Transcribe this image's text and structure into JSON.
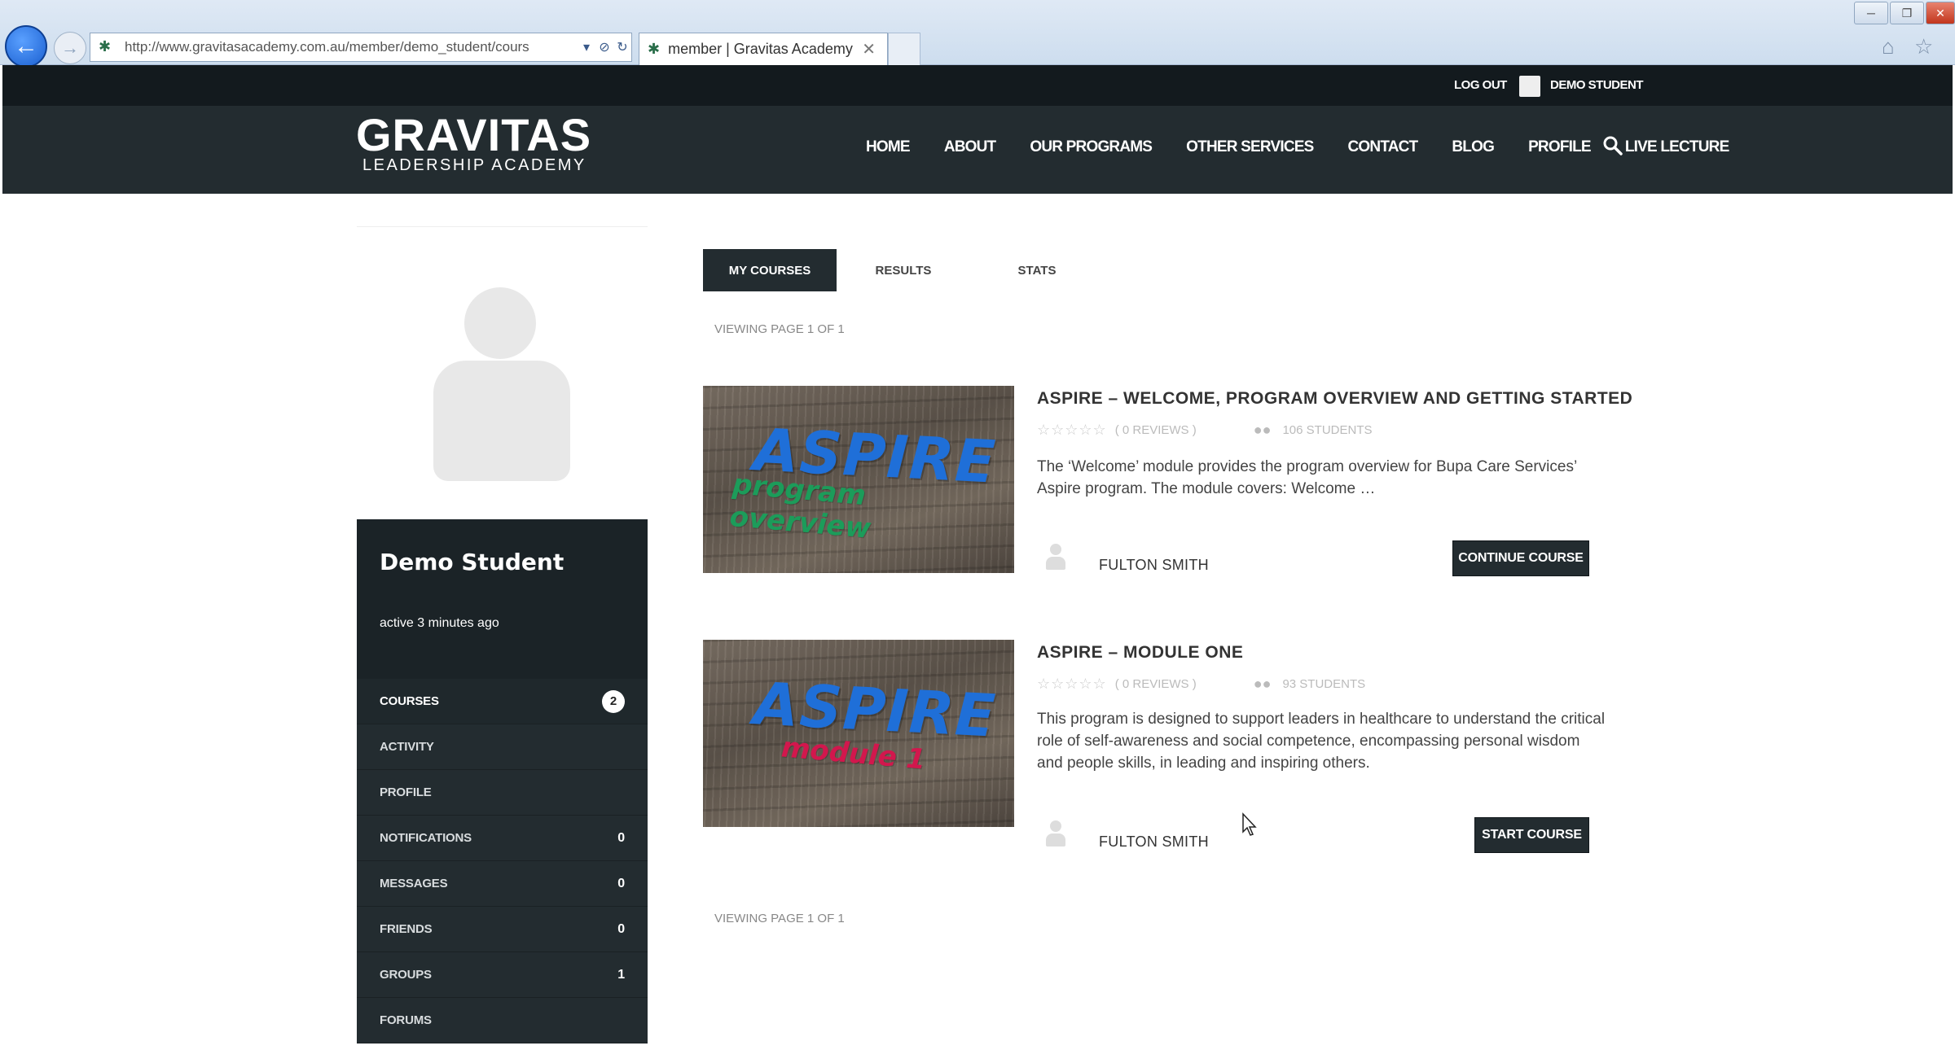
{
  "browser": {
    "url": "http://www.gravitasacademy.com.au/member/demo_student/cours",
    "tab_title": "member | Gravitas Academy"
  },
  "topbar": {
    "logout": "LOG OUT",
    "username": "DEMO STUDENT"
  },
  "header": {
    "logo_main": "GRAVITAS",
    "logo_sub": "LEADERSHIP ACADEMY",
    "nav": [
      "HOME",
      "ABOUT",
      "OUR PROGRAMS",
      "OTHER SERVICES",
      "CONTACT",
      "BLOG",
      "PROFILE",
      "LIVE LECTURE"
    ]
  },
  "sidebar": {
    "name": "Demo Student",
    "active": "active 3 minutes ago",
    "menu": [
      {
        "label": "COURSES",
        "count": "2"
      },
      {
        "label": "ACTIVITY",
        "count": ""
      },
      {
        "label": "PROFILE",
        "count": ""
      },
      {
        "label": "NOTIFICATIONS",
        "count": "0"
      },
      {
        "label": "MESSAGES",
        "count": "0"
      },
      {
        "label": "FRIENDS",
        "count": "0"
      },
      {
        "label": "GROUPS",
        "count": "1"
      },
      {
        "label": "FORUMS",
        "count": ""
      }
    ]
  },
  "content": {
    "tabs": [
      "MY COURSES",
      "RESULTS",
      "STATS"
    ],
    "viewing": "VIEWING PAGE 1 OF 1",
    "courses": [
      {
        "thumb_title": "ASPIRE",
        "thumb_sub": "program overview",
        "title": "ASPIRE – WELCOME, PROGRAM OVERVIEW AND GETTING STARTED",
        "reviews": "( 0 REVIEWS )",
        "students": "106 STUDENTS",
        "description": "The ‘Welcome’ module provides the program overview for Bupa Care Services’ Aspire program. The module covers: Welcome …",
        "instructor": "FULTON SMITH",
        "button": "CONTINUE COURSE"
      },
      {
        "thumb_title": "ASPIRE",
        "thumb_sub": "module 1",
        "title": "ASPIRE – MODULE ONE",
        "reviews": "( 0 REVIEWS )",
        "students": "93 STUDENTS",
        "description": "This program is designed to support leaders in healthcare to understand the critical role of self-awareness and social competence, encompassing personal wisdom and people skills, in leading and inspiring others.",
        "instructor": "FULTON SMITH",
        "button": "START COURSE"
      }
    ]
  }
}
